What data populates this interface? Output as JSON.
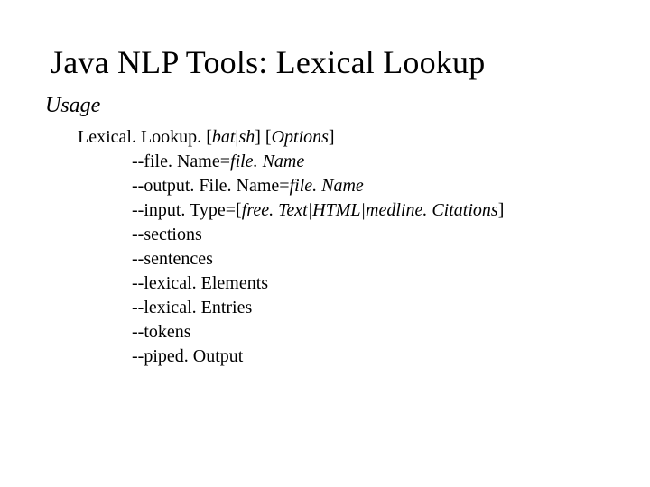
{
  "title": "Java NLP Tools: Lexical Lookup",
  "usage_label": "Usage",
  "command": {
    "name": "Lexical. Lookup.",
    "suffix_open": " [",
    "suffix_bat": "bat",
    "suffix_pipe": "|",
    "suffix_sh": "sh",
    "suffix_close": "] [",
    "suffix_options": "Options",
    "suffix_end": "]"
  },
  "options": [
    {
      "flag": "--file. Name=",
      "value": "file. Name",
      "value_italic": true
    },
    {
      "flag": "--output. File. Name=",
      "value": "file. Name",
      "value_italic": true
    },
    {
      "flag": "--input. Type=[",
      "value": "free. Text|HTML|medline. Citations",
      "value_italic": true,
      "suffix": "]"
    },
    {
      "flag": "--sections",
      "value": "",
      "value_italic": false
    },
    {
      "flag": "--sentences",
      "value": "",
      "value_italic": false
    },
    {
      "flag": "--lexical. Elements",
      "value": "",
      "value_italic": false
    },
    {
      "flag": "--lexical. Entries",
      "value": "",
      "value_italic": false
    },
    {
      "flag": "--tokens",
      "value": "",
      "value_italic": false
    },
    {
      "flag": "--piped. Output",
      "value": "",
      "value_italic": false
    }
  ]
}
